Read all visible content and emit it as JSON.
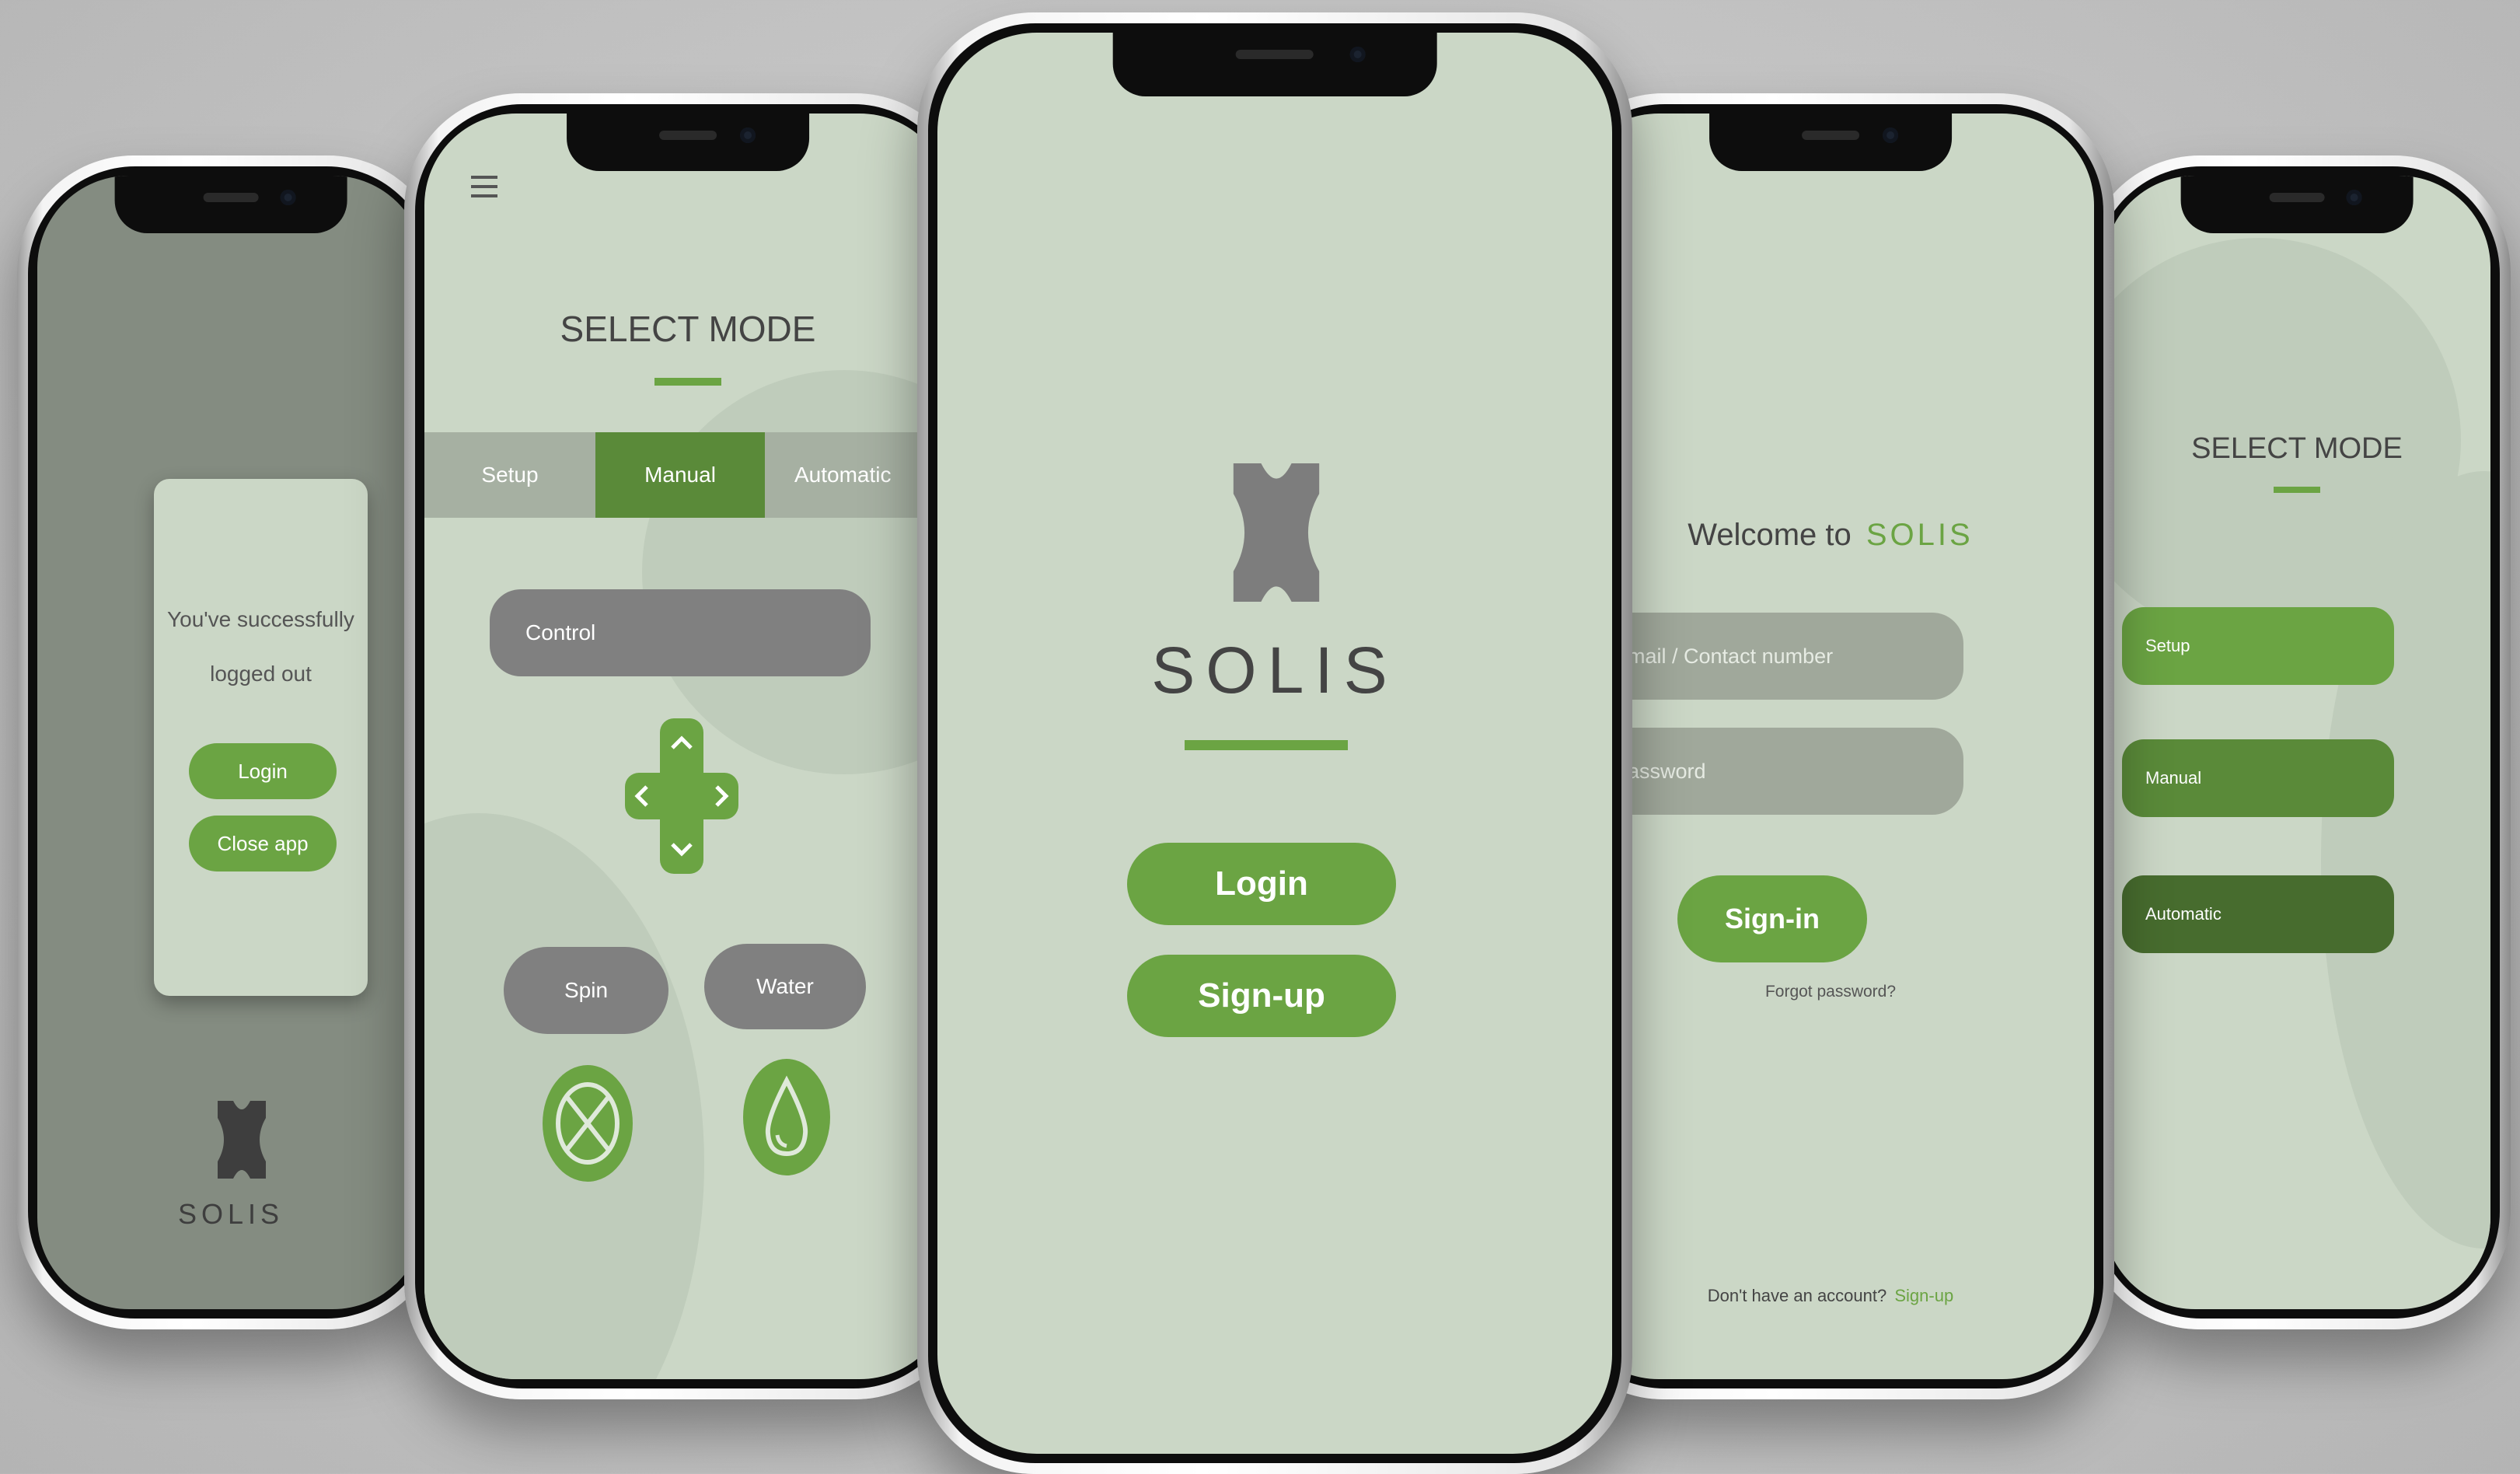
{
  "phone1": {
    "message_line1": "You've successfully",
    "message_line2": "logged out",
    "login_label": "Login",
    "close_label": "Close app",
    "brand": "SOLIS"
  },
  "phone2": {
    "menu_icon": "hamburger-icon",
    "title": "SELECT MODE",
    "tabs": [
      "Setup",
      "Manual",
      "Automatic"
    ],
    "control_label": "Control",
    "dpad_icon": "dpad-icon",
    "spin_label": "Spin",
    "water_label": "Water",
    "spin_icon": "spin-icon",
    "water_icon": "water-drop-icon"
  },
  "phone3": {
    "brand": "SOLIS",
    "login_label": "Login",
    "signup_label": "Sign-up"
  },
  "phone4": {
    "welcome_prefix": "Welcome to",
    "welcome_brand": "SOLIS",
    "email_placeholder": "Email / Contact number",
    "password_placeholder": "Password",
    "signin_label": "Sign-in",
    "forgot_label": "Forgot password?",
    "no_account_label": "Don't have an account?",
    "signup_link": "Sign-up"
  },
  "phone5": {
    "title": "SELECT MODE",
    "setup_label": "Setup",
    "manual_label": "Manual",
    "automatic_label": "Automatic"
  },
  "colors": {
    "accent": "#6ba443",
    "screen_bg": "#cbd7c6",
    "grey_button": "#808080",
    "text_dark": "#444444"
  }
}
